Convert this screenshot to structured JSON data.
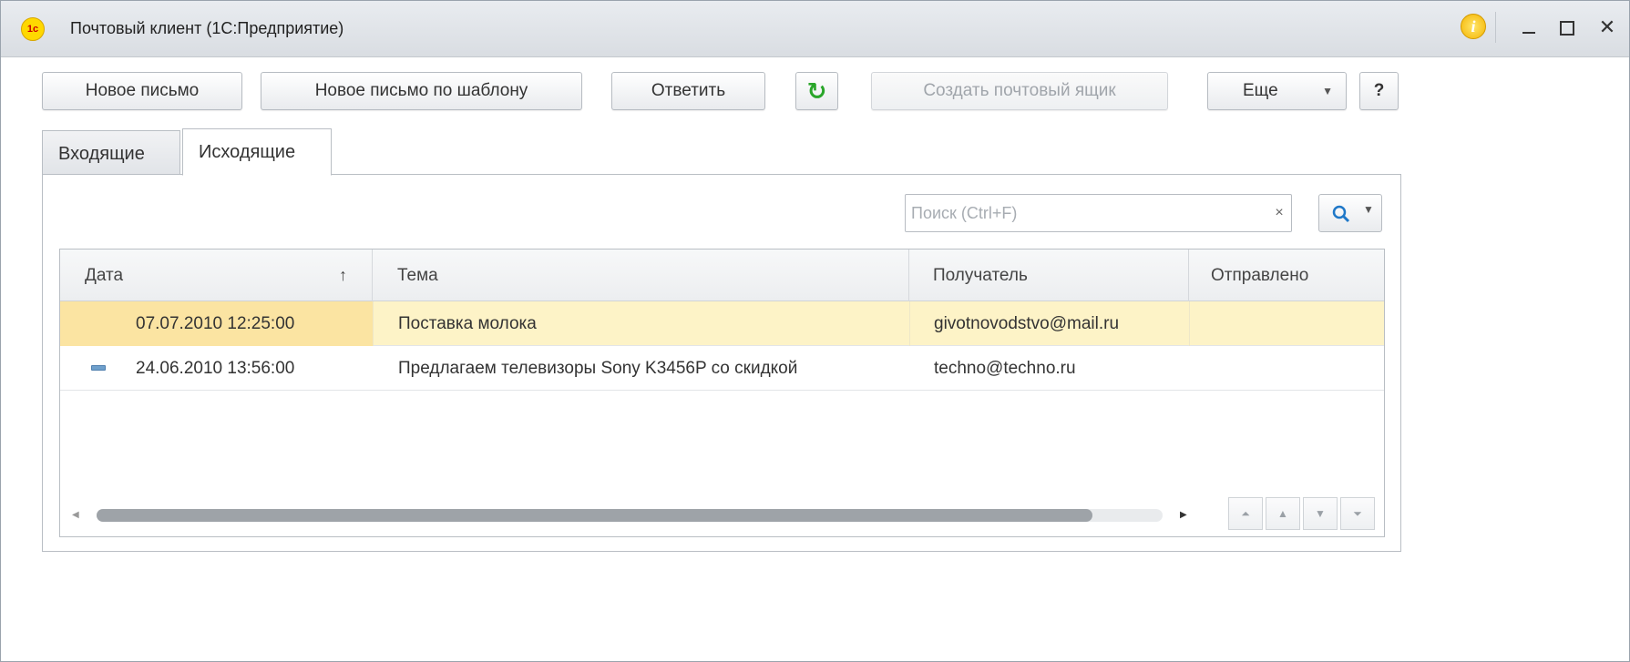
{
  "window": {
    "title": "Почтовый клиент  (1С:Предприятие)",
    "logo_text": "1c",
    "info_icon": "info-icon"
  },
  "toolbar": {
    "new_letter": "Новое письмо",
    "new_from_template": "Новое письмо по шаблону",
    "reply": "Ответить",
    "refresh_icon": "refresh-icon",
    "create_mailbox": "Создать почтовый ящик",
    "more": "Еще",
    "help": "?"
  },
  "tabs": [
    {
      "label": "Входящие",
      "active": false
    },
    {
      "label": "Исходящие",
      "active": true
    }
  ],
  "search": {
    "placeholder": "Поиск (Ctrl+F)",
    "value": "",
    "clear": "×"
  },
  "table": {
    "columns": [
      "Дата",
      "Тема",
      "Получатель",
      "Отправлено"
    ],
    "sort_indicator": "↑",
    "rows": [
      {
        "date": "07.07.2010 12:25:00",
        "subject": "Поставка молока",
        "recipient": "givotnovodstvo@mail.ru",
        "sent": "",
        "selected": true
      },
      {
        "date": "24.06.2010 13:56:00",
        "subject": "Предлагаем телевизоры Sony K3456P со скидкой",
        "recipient": "techno@techno.ru",
        "sent": "",
        "selected": false
      }
    ]
  },
  "colors": {
    "selected_row": "#fdf3c7",
    "selected_cell": "#fbe4a2",
    "refresh_green": "#2aa62a",
    "disabled_text": "#a0a5ab"
  }
}
